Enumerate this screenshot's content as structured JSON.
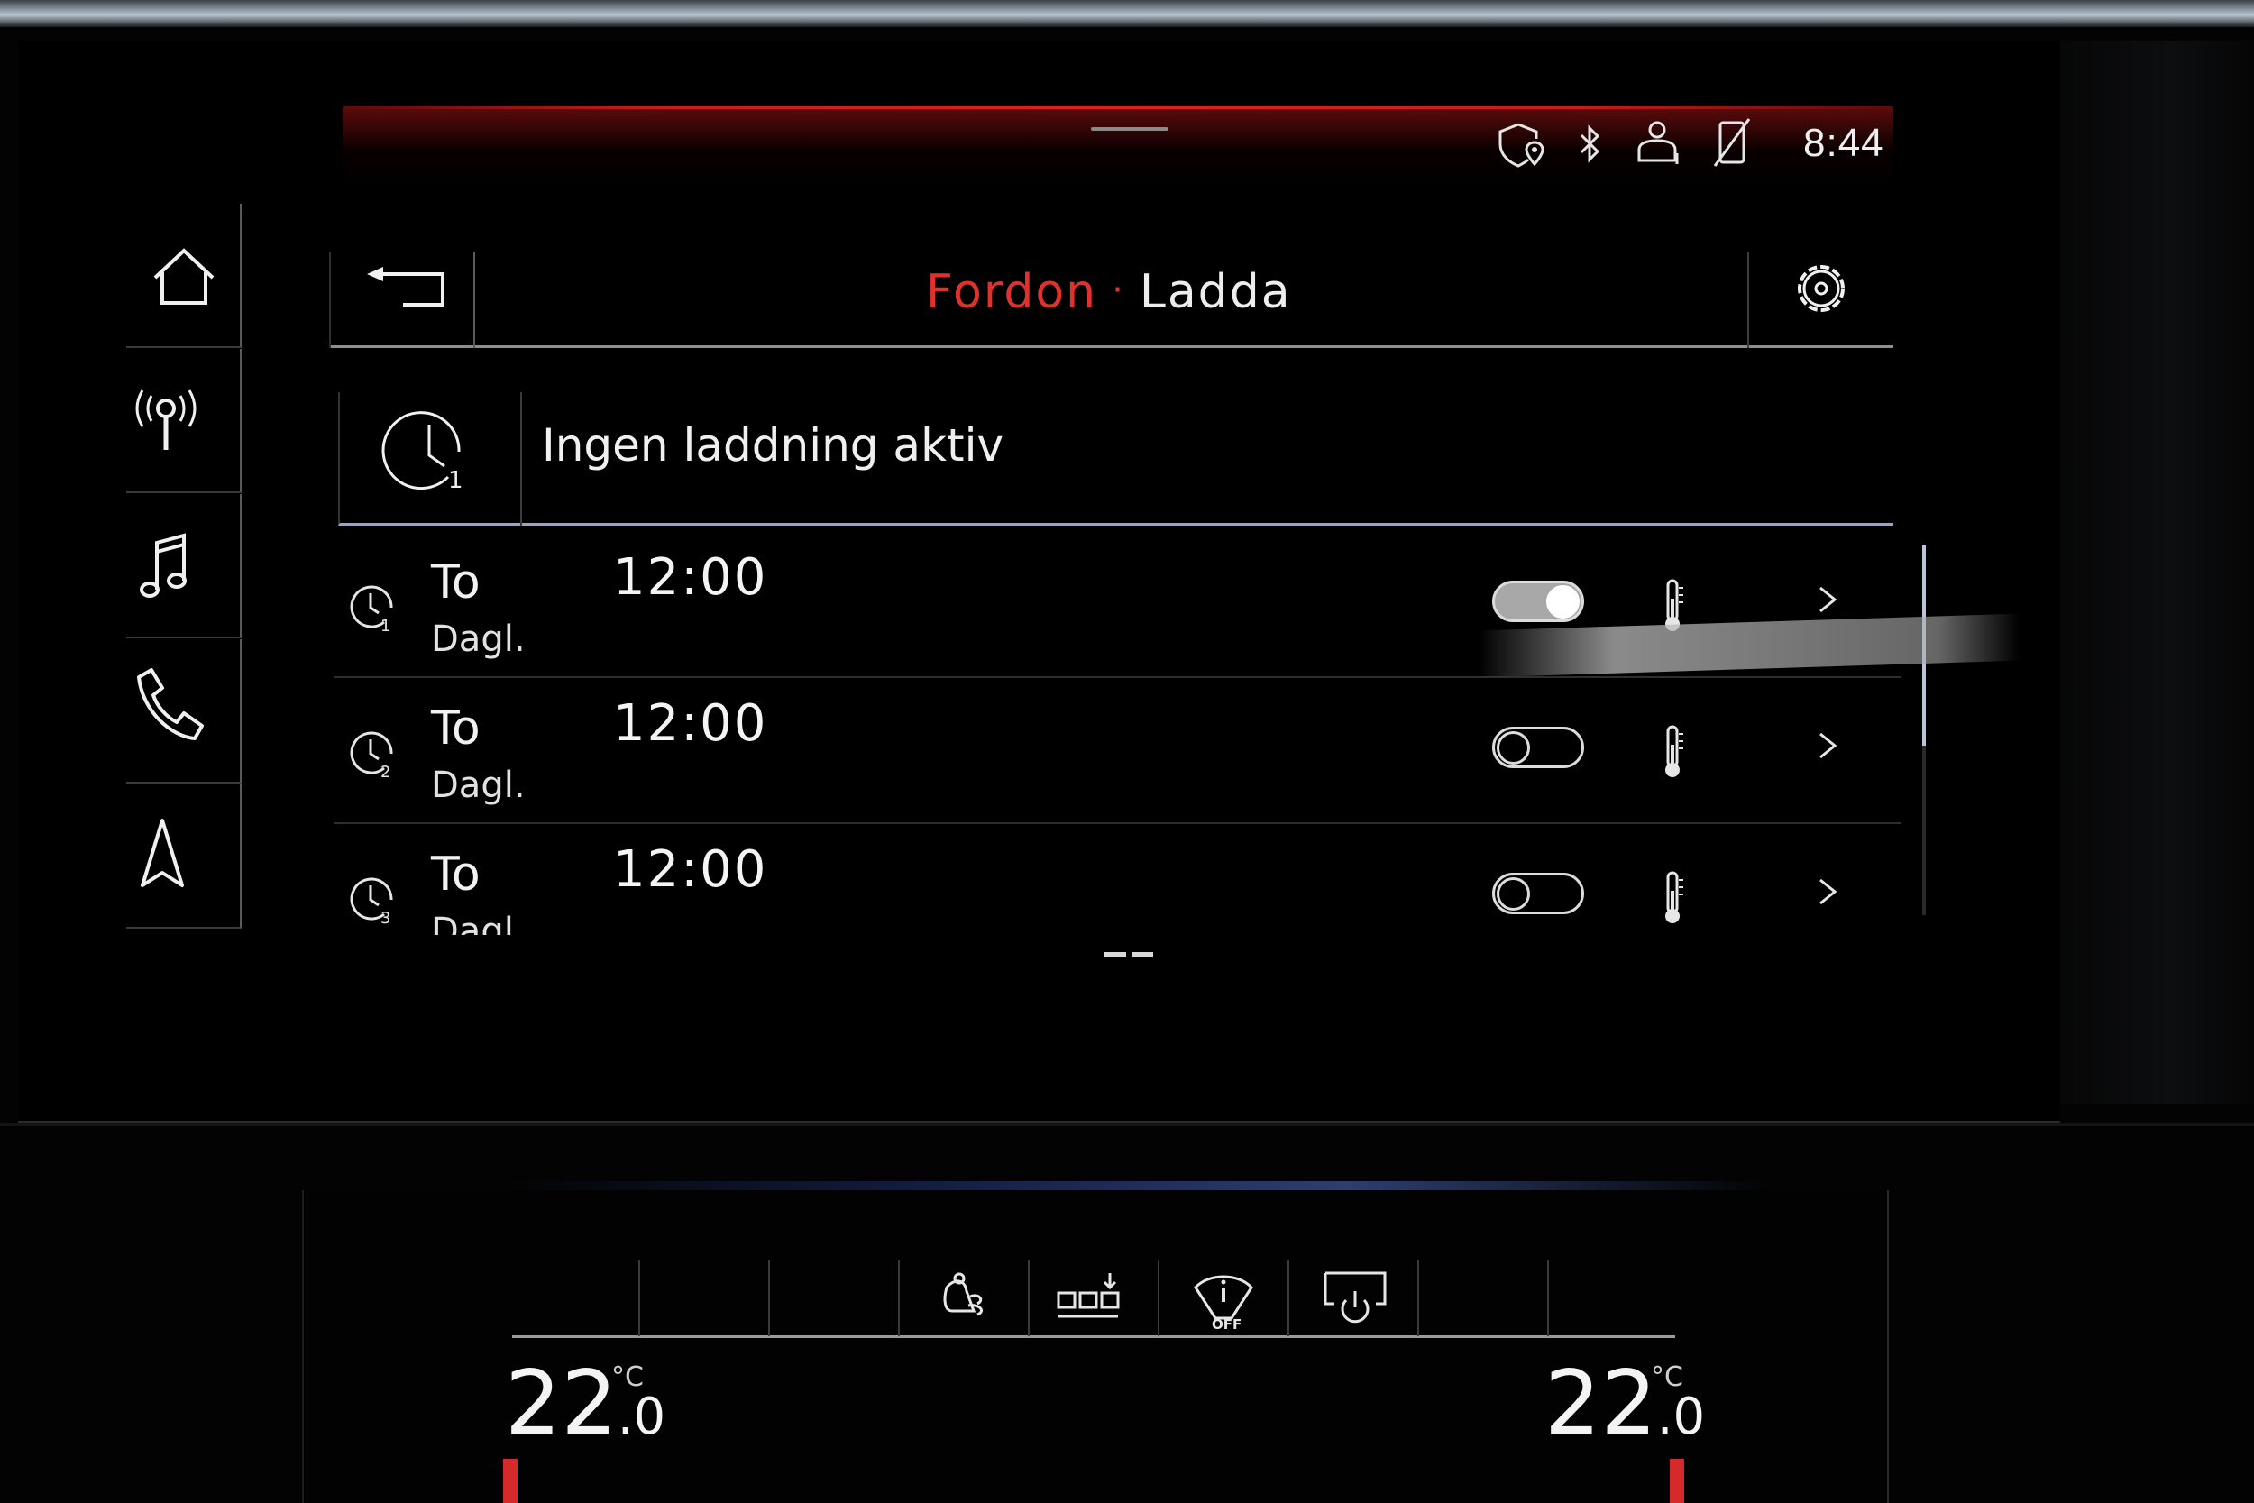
{
  "status_bar": {
    "time": "8:44",
    "icons": [
      "location-shield-icon",
      "bluetooth-icon",
      "user-profile-icon",
      "phone-no-signal-icon"
    ]
  },
  "sidebar": {
    "items": [
      {
        "icon": "home-icon"
      },
      {
        "icon": "radio-icon"
      },
      {
        "icon": "music-note-icon"
      },
      {
        "icon": "phone-icon"
      },
      {
        "icon": "navigation-arrow-icon"
      }
    ]
  },
  "header": {
    "breadcrumb": "Fordon",
    "separator": "·",
    "title": "Ladda"
  },
  "charge_status": {
    "text": "Ingen laddning aktiv",
    "icon_badge": "1"
  },
  "timers": [
    {
      "badge": "1",
      "day": "To",
      "frequency": "Dagl.",
      "time": "12:00",
      "enabled": true
    },
    {
      "badge": "2",
      "day": "To",
      "frequency": "Dagl.",
      "time": "12:00",
      "enabled": false
    },
    {
      "badge": "3",
      "day": "To",
      "frequency": "Dagl.",
      "time": "12:00",
      "enabled": false
    }
  ],
  "climate": {
    "left_temp": {
      "whole": "22",
      "decimal": ".0",
      "unit": "°C"
    },
    "right_temp": {
      "whole": "22",
      "decimal": ".0",
      "unit": "°C"
    },
    "wiper_label": "OFF"
  },
  "colors": {
    "accent_red": "#e0322c",
    "background": "#000000",
    "divider": "#8e8e8e",
    "active_divider": "#9aa6b8"
  }
}
